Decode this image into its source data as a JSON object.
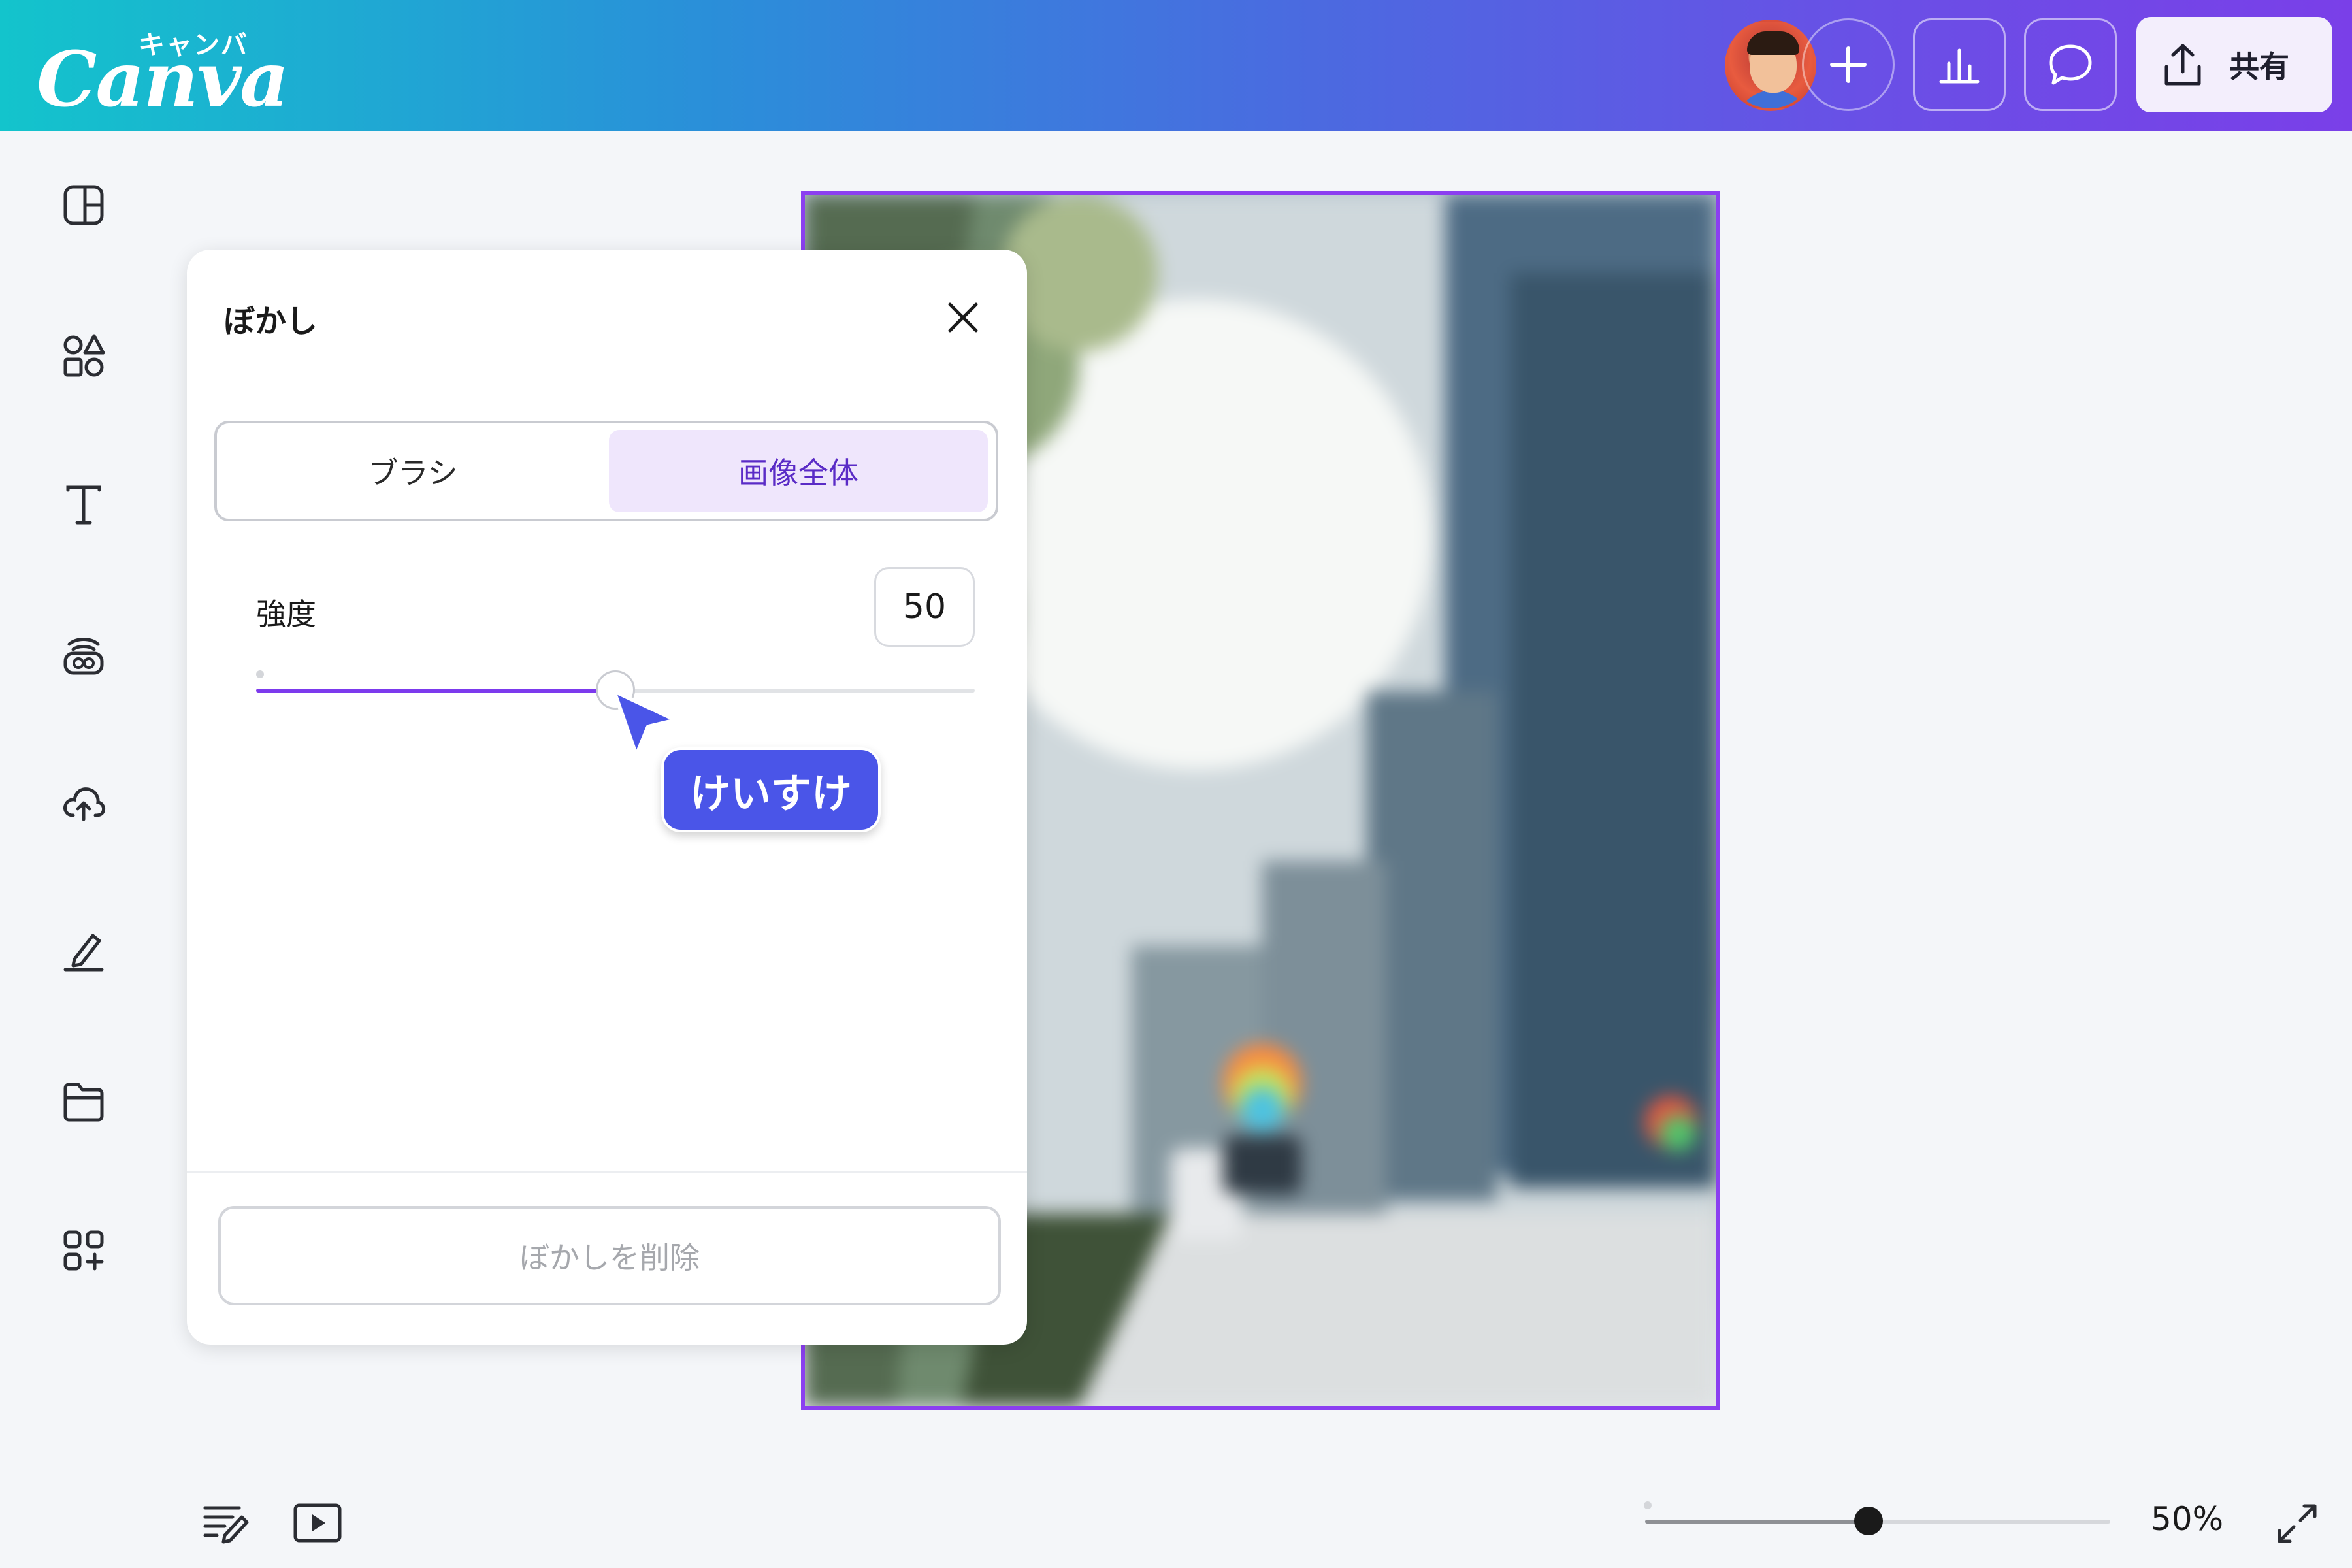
{
  "header": {
    "logo_kana": "キャンバ",
    "logo_word": "Canva",
    "share_label": "共有"
  },
  "panel": {
    "title": "ぼかし",
    "tabs": [
      {
        "label": "ブラシ",
        "selected": false
      },
      {
        "label": "画像全体",
        "selected": true
      }
    ],
    "strength_label": "強度",
    "strength_value": "50",
    "strength_fraction": 0.5,
    "remove_label": "ぼかしを削除"
  },
  "collaborator": {
    "name": "けいすけ",
    "color": "#4a55e8"
  },
  "footer": {
    "zoom_label": "50%",
    "zoom_fraction": 0.48
  },
  "sidebar": {
    "icons": [
      "template-icon",
      "elements-icon",
      "text-icon",
      "brand-icon",
      "uploads-icon",
      "draw-icon",
      "projects-icon",
      "apps-icon"
    ]
  },
  "colors": {
    "accent": "#7c3aed",
    "selection": "#8b3ff0",
    "segment_selected_bg": "#efe6fc",
    "segment_selected_text": "#5a2bc6"
  }
}
